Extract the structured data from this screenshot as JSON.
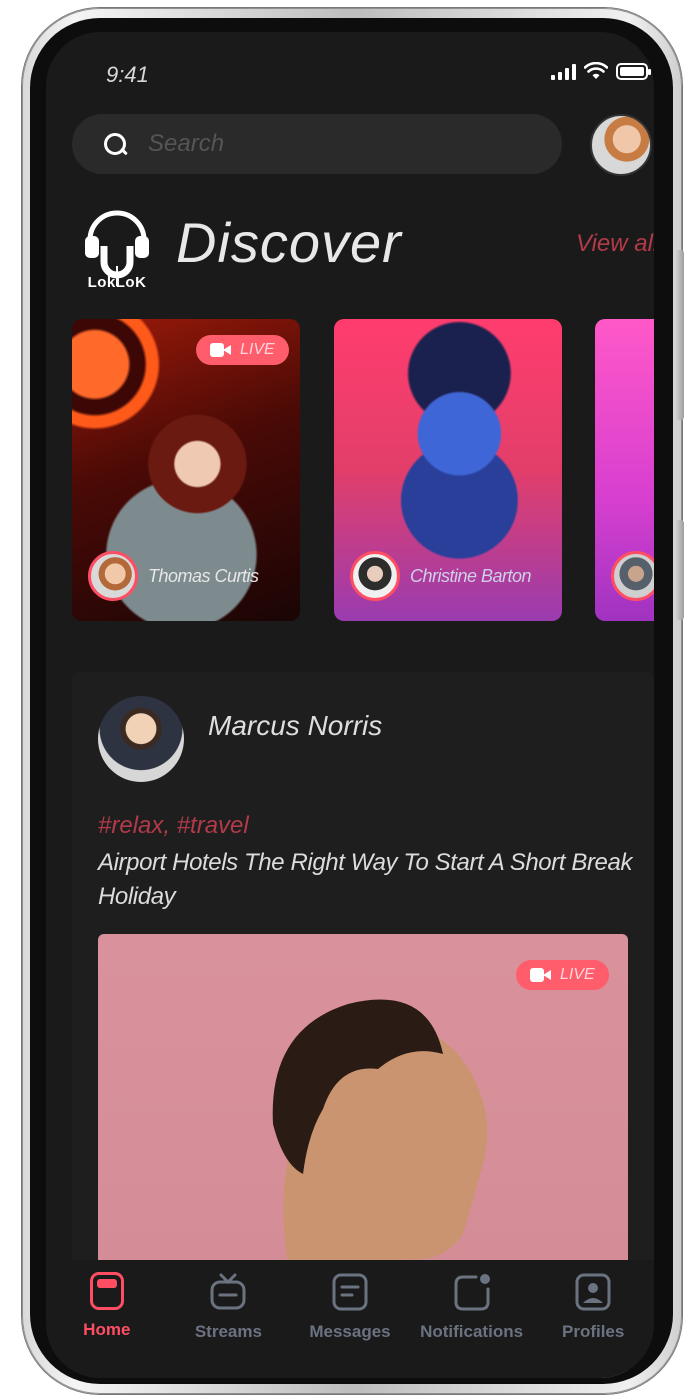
{
  "status_bar": {
    "time": "9:41"
  },
  "search": {
    "placeholder": "Search"
  },
  "header": {
    "logo_text": "LokLoK",
    "title": "Discover",
    "view_all": "View all"
  },
  "stories": [
    {
      "name": "Thomas Curtis",
      "live": "LIVE"
    },
    {
      "name": "Christine Barton"
    },
    {
      "name": ""
    }
  ],
  "post": {
    "author": "Marcus Norris",
    "tags": "#relax, #travel",
    "text": "Airport Hotels The Right Way To Start A Short Break Holiday",
    "live": "LIVE"
  },
  "nav": [
    {
      "label": "Home",
      "icon": "home-icon",
      "active": true
    },
    {
      "label": "Streams",
      "icon": "tv-icon"
    },
    {
      "label": "Messages",
      "icon": "message-icon"
    },
    {
      "label": "Notifications",
      "icon": "notification-icon"
    },
    {
      "label": "Profiles",
      "icon": "profile-icon"
    }
  ],
  "colors": {
    "accent": "#ff4d63",
    "tag": "#b23a49",
    "background": "#1a1a1a"
  }
}
